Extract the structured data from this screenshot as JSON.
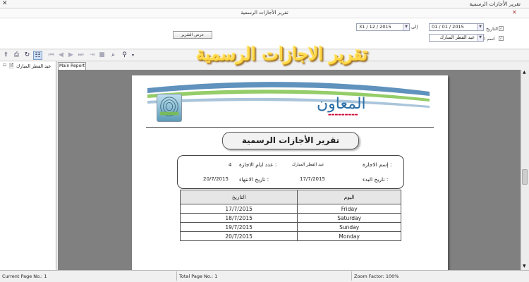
{
  "window": {
    "title": "تقرير الأجازات الرسمية",
    "subtitle": "تقرير الأجازات الرسمية"
  },
  "params": {
    "date_label": "التاريخ",
    "holiday_name_label": "اسم الاجازة",
    "from_date": "01 / 01 / 2015",
    "to_label": "إلى",
    "to_date": "31 / 12 / 2015",
    "holiday_name_value": "عيد الفطر المبارك",
    "show_button": "عرض التقرير"
  },
  "banner": {
    "text": "تقرير الاجازات الرسمية"
  },
  "nav": {
    "tree_item": "عيد الفطر المبارك"
  },
  "tabs": {
    "main_report": "Main Report"
  },
  "report": {
    "brand_name": "المعاون",
    "title": "تقرير الأجازات الرسمية",
    "holiday_name_label": "إسم الاجازة :",
    "holiday_name_value": "عيد الفطر المبارك",
    "days_label": "عدد ايام الاجازة :",
    "days_value": "4",
    "start_label": "تاريخ البدء :",
    "start_value": "17/7/2015",
    "end_label": "تاريخ الانتهاء :",
    "end_value": "20/7/2015",
    "table": {
      "headers": [
        "اليوم",
        "التاريخ"
      ],
      "rows": [
        {
          "day": "Friday",
          "date": "17/7/2015"
        },
        {
          "day": "Saturday",
          "date": "18/7/2015"
        },
        {
          "day": "Sunday",
          "date": "19/7/2015"
        },
        {
          "day": "Monday",
          "date": "20/7/2015"
        }
      ]
    }
  },
  "status": {
    "current_page": "Current Page No.: 1",
    "total_page": "Total Page No.: 1",
    "zoom": "Zoom Factor: 100%"
  },
  "colors": {
    "banner": "#ffd84a",
    "brand": "#2a6ea6",
    "viewer_bg": "#808080"
  },
  "icons": [
    "close-icon",
    "export-icon",
    "print-icon",
    "refresh-icon",
    "group-tree-icon",
    "first-page-icon",
    "prev-page-icon",
    "next-page-icon",
    "last-page-icon",
    "goto-icon",
    "stop-icon",
    "search-icon",
    "zoom-icon",
    "calendar-icon",
    "dropdown-icon",
    "document-icon"
  ]
}
